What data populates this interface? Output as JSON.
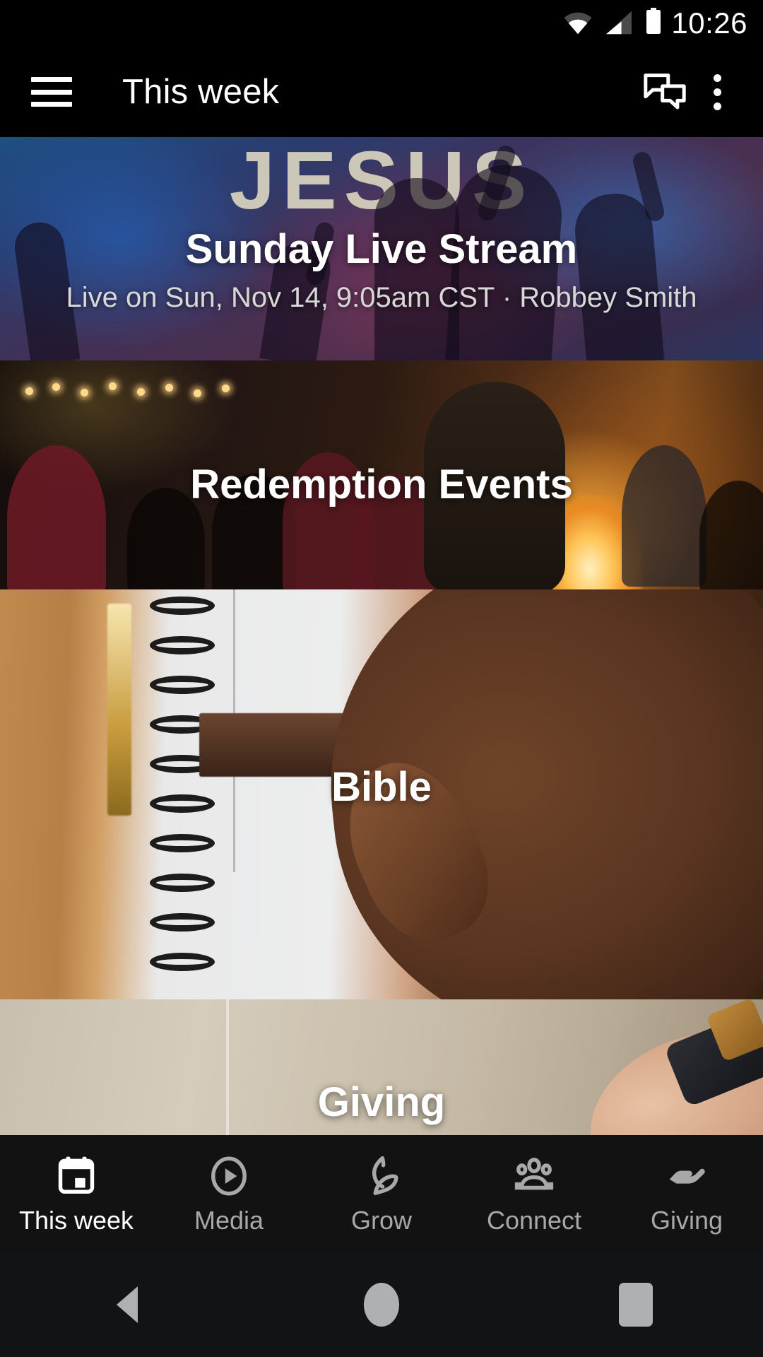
{
  "status_bar": {
    "time": "10:26",
    "icons": [
      "wifi-icon",
      "cellular-signal-icon",
      "battery-icon"
    ]
  },
  "app_bar": {
    "menu_icon": "hamburger-menu-icon",
    "title": "This week",
    "chat_icon": "chat-bubbles-icon",
    "overflow_icon": "overflow-menu-icon"
  },
  "cards": [
    {
      "id": "live",
      "title": "Sunday Live Stream",
      "subtitle": "Live on Sun, Nov 14, 9:05am CST · Robbey Smith",
      "art_text": "JESUS"
    },
    {
      "id": "events",
      "title": "Redemption Events",
      "subtitle": ""
    },
    {
      "id": "bible",
      "title": "Bible",
      "subtitle": ""
    },
    {
      "id": "giving",
      "title": "Giving",
      "subtitle": ""
    }
  ],
  "bottom_nav": {
    "items": [
      {
        "label": "This week",
        "icon": "calendar-icon",
        "active": true
      },
      {
        "label": "Media",
        "icon": "play-circle-icon",
        "active": false
      },
      {
        "label": "Grow",
        "icon": "leaf-icon",
        "active": false
      },
      {
        "label": "Connect",
        "icon": "people-group-icon",
        "active": false
      },
      {
        "label": "Giving",
        "icon": "open-hand-icon",
        "active": false
      }
    ]
  },
  "android_nav": {
    "back": "back-triangle-icon",
    "home": "home-circle-icon",
    "recents": "recents-square-icon"
  },
  "colors": {
    "app_bar_bg": "#000000",
    "bottom_nav_bg": "#121212",
    "active_text": "#ffffff",
    "inactive_text": "#a8a8a8"
  }
}
